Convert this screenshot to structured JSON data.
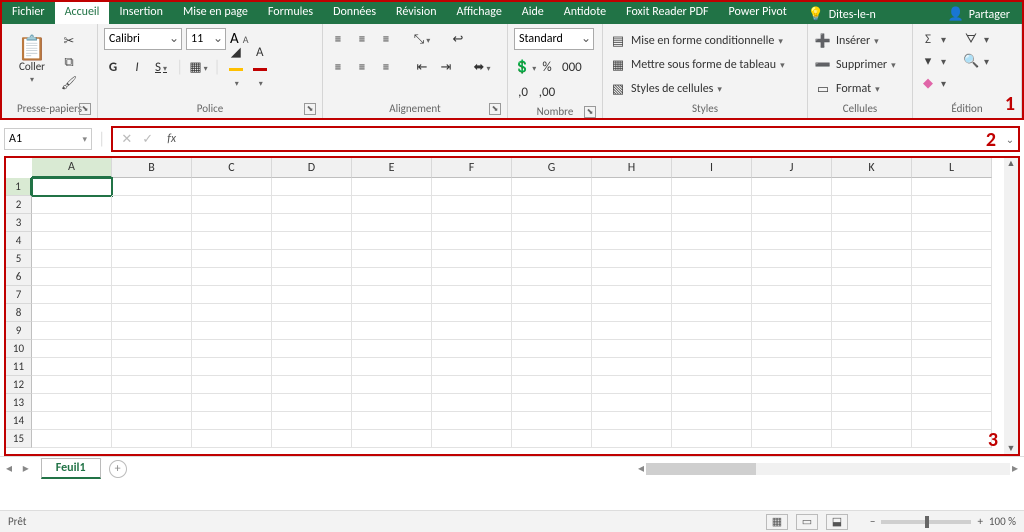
{
  "tabs": {
    "file": "Fichier",
    "home": "Accueil",
    "insert": "Insertion",
    "layout": "Mise en page",
    "formulas": "Formules",
    "data": "Données",
    "review": "Révision",
    "view": "Affichage",
    "help": "Aide",
    "antidote": "Antidote",
    "foxit": "Foxit Reader PDF",
    "powerpivot": "Power Pivot",
    "tellme": "Dites-le-n",
    "share": "Partager"
  },
  "ribbon": {
    "clipboard": {
      "paste": "Coller",
      "label": "Presse-papiers"
    },
    "font": {
      "name": "Calibri",
      "size": "11",
      "bold": "G",
      "italic": "I",
      "underline": "S",
      "label": "Police",
      "increase": "A",
      "decrease": "A"
    },
    "alignment": {
      "label": "Alignement"
    },
    "number": {
      "format": "Standard",
      "label": "Nombre",
      "percent": "%",
      "thousands": "000",
      "inc": ",0",
      "dec": ",00"
    },
    "styles": {
      "conditional": "Mise en forme conditionnelle",
      "astable": "Mettre sous forme de tableau",
      "cellstyles": "Styles de cellules",
      "label": "Styles"
    },
    "cells": {
      "insert": "Insérer",
      "delete": "Supprimer",
      "format": "Format",
      "label": "Cellules"
    },
    "editing": {
      "label": "Édition"
    }
  },
  "annotations": {
    "one": "1",
    "two": "2",
    "three": "3"
  },
  "formula_bar": {
    "cellref": "A1",
    "fx": "fx",
    "value": ""
  },
  "grid": {
    "columns": [
      "A",
      "B",
      "C",
      "D",
      "E",
      "F",
      "G",
      "H",
      "I",
      "J",
      "K",
      "L"
    ],
    "rows": [
      "1",
      "2",
      "3",
      "4",
      "5",
      "6",
      "7",
      "8",
      "9",
      "10",
      "11",
      "12",
      "13",
      "14",
      "15"
    ],
    "active": "A1"
  },
  "sheet": {
    "name": "Feuil1"
  },
  "status": {
    "ready": "Prêt",
    "zoom": "100 %",
    "minus": "−",
    "plus": "+"
  }
}
